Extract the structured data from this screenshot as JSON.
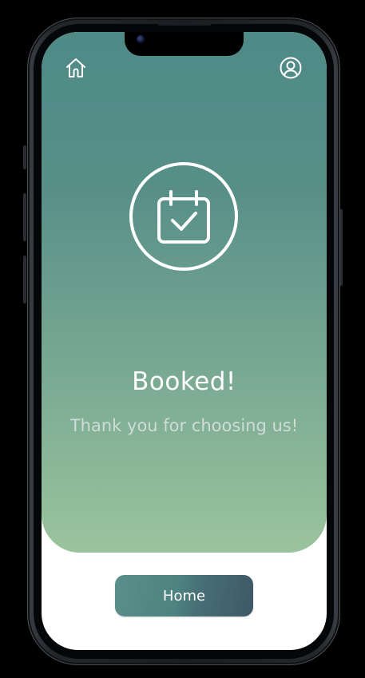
{
  "header": {
    "home_icon": "home-icon",
    "profile_icon": "user-circle-icon"
  },
  "confirmation": {
    "badge_icon": "calendar-check-icon",
    "title": "Booked!",
    "message": "Thank you for choosing us!"
  },
  "actions": {
    "home_label": "Home"
  },
  "colors": {
    "gradient_top": "#4f8a87",
    "gradient_bottom": "#9ac49d",
    "button_start": "#5a8f8a",
    "button_end": "#3e5866",
    "text_primary": "#ffffff"
  }
}
